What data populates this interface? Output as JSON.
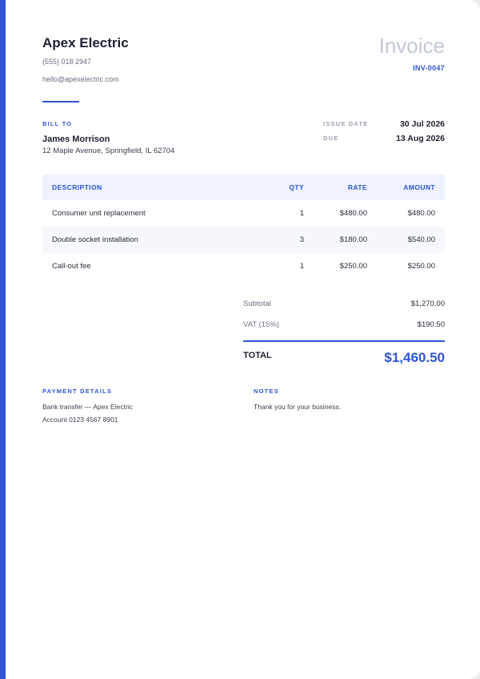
{
  "colors": {
    "accent": "#2f55d4",
    "title_muted": "#c3c8d6",
    "header_fill": "#eef2fd"
  },
  "company": {
    "name": "Apex Electric",
    "phone": "(555) 018 2947",
    "email": "hello@apexelectric.com"
  },
  "document": {
    "title": "Invoice",
    "number": "INV-0047"
  },
  "bill_to": {
    "label": "BILL TO",
    "name": "James Morrison",
    "address": "12 Maple Avenue, Springfield, IL 62704"
  },
  "meta": {
    "issue_date_label": "ISSUE DATE",
    "issue_date": "30 Jul 2026",
    "due_label": "DUE",
    "due_date": "13 Aug 2026"
  },
  "table": {
    "headers": {
      "description": "DESCRIPTION",
      "qty": "QTY",
      "rate": "RATE",
      "amount": "AMOUNT"
    },
    "rows": [
      {
        "description": "Consumer unit replacement",
        "qty": "1",
        "rate": "$480.00",
        "amount": "$480.00"
      },
      {
        "description": "Double socket installation",
        "qty": "3",
        "rate": "$180.00",
        "amount": "$540.00"
      },
      {
        "description": "Call-out fee",
        "qty": "1",
        "rate": "$250.00",
        "amount": "$250.00"
      }
    ]
  },
  "totals": {
    "subtotal_label": "Subtotal",
    "subtotal": "$1,270.00",
    "vat_label": "VAT (15%)",
    "vat": "$190.50",
    "total_label": "TOTAL",
    "total": "$1,460.50"
  },
  "payment": {
    "label": "PAYMENT DETAILS",
    "line1": "Bank transfer — Apex Electric",
    "line2": "Account 0123 4567 8901"
  },
  "notes": {
    "label": "NOTES",
    "text": "Thank you for your business."
  }
}
